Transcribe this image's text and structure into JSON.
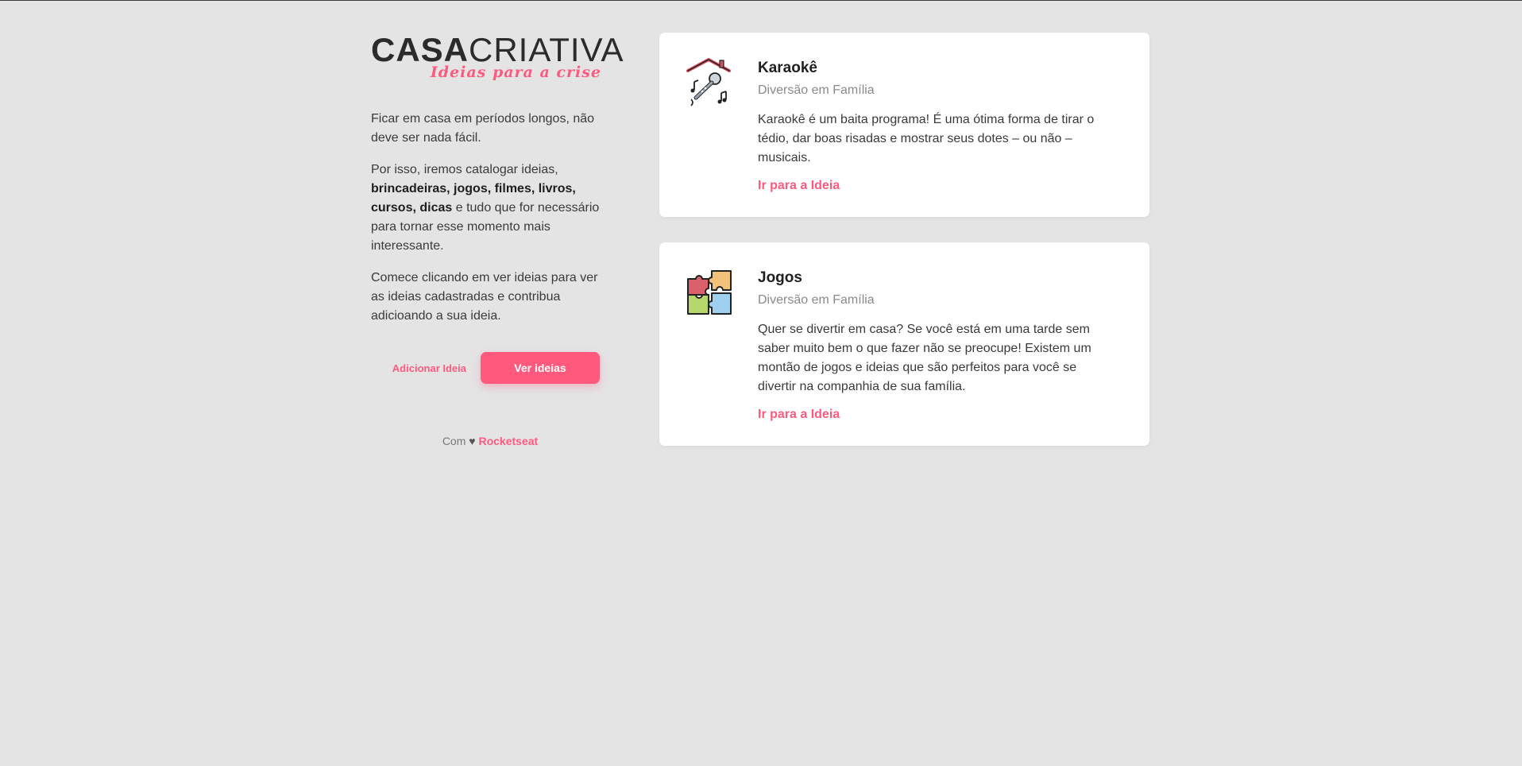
{
  "brand": {
    "logo_part1": "CASA",
    "logo_part2": "CRIATIVA",
    "tagline": "Ideias para a crise",
    "accent_color": "#ff5a7e"
  },
  "sidebar": {
    "paragraph1": "Ficar em casa em períodos longos, não deve ser nada fácil.",
    "paragraph2_start": "Por isso, iremos catalogar ideias, ",
    "paragraph2_bold": "brincadeiras, jogos, filmes, livros, cursos, dicas",
    "paragraph2_end": " e tudo que for necessário para tornar esse momento mais interessante.",
    "paragraph3": "Comece clicando em ver ideias para ver as ideias cadastradas e contribua adicioando a sua ideia.",
    "add_label": "Adicionar Ideia",
    "view_label": "Ver ideias"
  },
  "footer": {
    "prefix": "Com",
    "heart": "♥",
    "brand": "Rocketseat"
  },
  "cards": [
    {
      "icon": "karaoke-icon",
      "title": "Karaokê",
      "category": "Diversão em Família",
      "description": "Karaokê é um baita programa! É uma ótima forma de tirar o tédio, dar boas risadas e mostrar seus dotes – ou não – musicais.",
      "link": "Ir para a Ideia"
    },
    {
      "icon": "puzzle-icon",
      "title": "Jogos",
      "category": "Diversão em Família",
      "description": "Quer se divertir em casa? Se você está em uma tarde sem saber muito bem o que fazer não se preocupe! Existem um montão de jogos e ideias que são perfeitos para você se divertir na companhia de sua família.",
      "link": "Ir para a Ideia"
    }
  ]
}
